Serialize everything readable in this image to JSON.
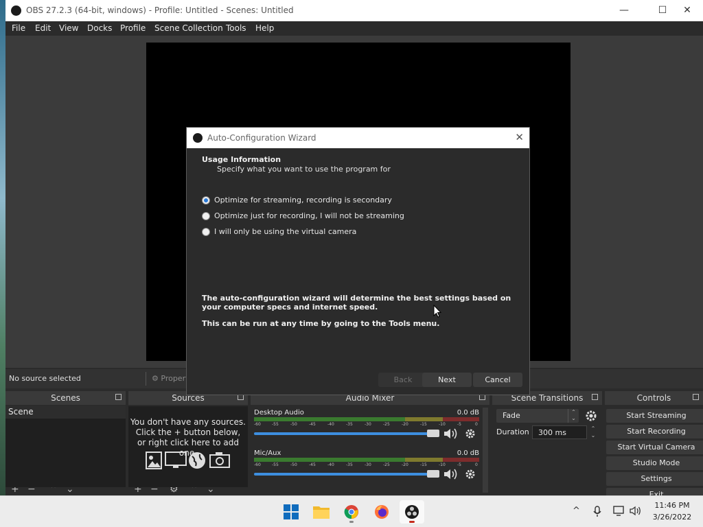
{
  "window": {
    "title": "OBS 27.2.3 (64-bit, windows) - Profile: Untitled - Scenes: Untitled",
    "minimize": "—",
    "maximize": "☐",
    "close": "✕"
  },
  "menu": [
    "File",
    "Edit",
    "View",
    "Docks",
    "Profile",
    "Scene Collection",
    "Tools",
    "Help"
  ],
  "source_toolbar": {
    "no_source": "No source selected",
    "properties": "Propert"
  },
  "docks": {
    "scenes": {
      "title": "Scenes",
      "items": [
        "Scene"
      ]
    },
    "sources": {
      "title": "Sources",
      "empty_message": "You don't have any sources.\nClick the + button below,\nor right click here to add one."
    },
    "mixer": {
      "title": "Audio Mixer",
      "channels": [
        {
          "name": "Desktop Audio",
          "db": "0.0 dB"
        },
        {
          "name": "Mic/Aux",
          "db": "0.0 dB"
        }
      ],
      "ticks": [
        "-60",
        "-55",
        "-50",
        "-45",
        "-40",
        "-35",
        "-30",
        "-25",
        "-20",
        "-15",
        "-10",
        "-5",
        "0"
      ]
    },
    "transitions": {
      "title": "Scene Transitions",
      "selected": "Fade",
      "duration_label": "Duration",
      "duration_value": "300 ms"
    },
    "controls": {
      "title": "Controls",
      "buttons": [
        "Start Streaming",
        "Start Recording",
        "Start Virtual Camera",
        "Studio Mode",
        "Settings",
        "Exit"
      ]
    }
  },
  "dialog": {
    "title": "Auto-Configuration Wizard",
    "close": "✕",
    "heading": "Usage Information",
    "subheading": "Specify what you want to use the program for",
    "options": [
      {
        "label": "Optimize for streaming, recording is secondary",
        "checked": true
      },
      {
        "label": "Optimize just for recording, I will not be streaming",
        "checked": false
      },
      {
        "label": "I will only be using the virtual camera",
        "checked": false
      }
    ],
    "info": "The auto-configuration wizard will determine the best settings based on your computer specs and internet speed.",
    "info2": "This can be run at any time by going to the Tools menu.",
    "buttons": {
      "back": "Back",
      "next": "Next",
      "cancel": "Cancel"
    }
  },
  "taskbar": {
    "apps": [
      "start-icon",
      "file-explorer-icon",
      "chrome-icon",
      "firefox-icon",
      "obs-icon"
    ],
    "time": "11:46 PM",
    "date": "3/26/2022",
    "tray": {
      "chevron": "^"
    }
  }
}
